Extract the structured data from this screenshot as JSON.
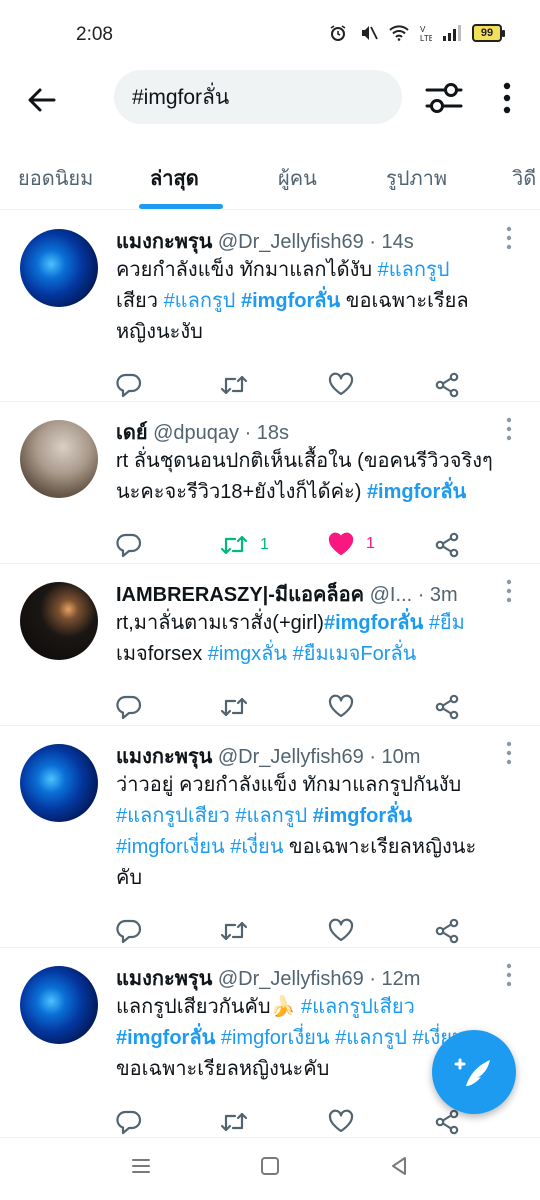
{
  "status_bar": {
    "time": "2:08",
    "battery": "99"
  },
  "search": {
    "query": "#imgforลั่น"
  },
  "tabs": [
    {
      "label": "ยอดนิยม"
    },
    {
      "label": "ล่าสุด"
    },
    {
      "label": "ผู้คน"
    },
    {
      "label": "รูปภาพ"
    },
    {
      "label": "วิดี"
    }
  ],
  "tweets": [
    {
      "name": "แมงกะพรุน",
      "handle": "@Dr_Jellyfish69 · 14s",
      "lines": [
        [
          "ควยกำลังแข็ง ทักมาแลกได้งับ ",
          "#แลกรูป"
        ],
        [
          "เสียว",
          " ",
          "#แลกรูป",
          " ",
          "#imgforลั่น",
          " ขอเฉพาะเรียล"
        ],
        [
          "หญิงนะงับ"
        ]
      ],
      "retweets": "",
      "likes": ""
    },
    {
      "name": "เดย์",
      "handle": "@dpuqay · 18s",
      "lines": [
        [
          "rt ลั่นชุดนอนปกติเห็นเสื้อใน (ขอคนรีวิวจริงๆ"
        ],
        [
          "นะคะจะรีวิว18+ยังไงก็ได้ค่ะ) ",
          "#imgforลั่น"
        ]
      ],
      "retweets": "1",
      "likes": "1"
    },
    {
      "name": "IAMBRERASZY|-มีแอคล็อค",
      "handle": "@I... · 3m",
      "lines": [
        [
          "rt,มาลั่นตามเราสั่ง(+girl)",
          "#imgforลั่น",
          " ",
          "#ยืม"
        ],
        [
          "เมจforsex",
          " ",
          "#imgxลั่น",
          " ",
          "#ยืมเมจForลั่น"
        ]
      ],
      "retweets": "",
      "likes": ""
    },
    {
      "name": "แมงกะพรุน",
      "handle": "@Dr_Jellyfish69 · 10m",
      "lines": [
        [
          "ว่าวอยู่ ควยกำลังแข็ง ทักมาแลกรูปกันงับ"
        ],
        [
          "#แลกรูปเสียว",
          " ",
          "#แลกรูป",
          " ",
          "#imgforลั่น"
        ],
        [
          "#imgforเงี่ยน",
          "  ",
          "#เงี่ยน",
          " ขอเฉพาะเรียลหญิงนะ"
        ],
        [
          "คับ"
        ]
      ],
      "retweets": "",
      "likes": ""
    },
    {
      "name": "แมงกะพรุน",
      "handle": "@Dr_Jellyfish69 · 12m",
      "lines": [
        [
          "แลกรูปเสียวกันคับ🍌 ",
          "#แลกรูปเสียว"
        ],
        [
          "#imgforลั่น",
          " ",
          "#imgforเงี่ยน",
          " ",
          "#แลกรูป",
          " ",
          "#เงี่ยน"
        ],
        [
          "ขอเฉพาะเรียลหญิงนะคับ"
        ]
      ],
      "retweets": "",
      "likes": ""
    }
  ],
  "colors": {
    "accent": "#1d9bf0",
    "retweet_active": "#00ba7c",
    "like_active": "#f91880",
    "secondary_text": "#536471"
  },
  "icons": [
    "back-arrow-icon",
    "filter-sliders-icon",
    "more-vertical-icon",
    "reply-icon",
    "retweet-icon",
    "like-icon",
    "share-icon",
    "compose-icon"
  ]
}
